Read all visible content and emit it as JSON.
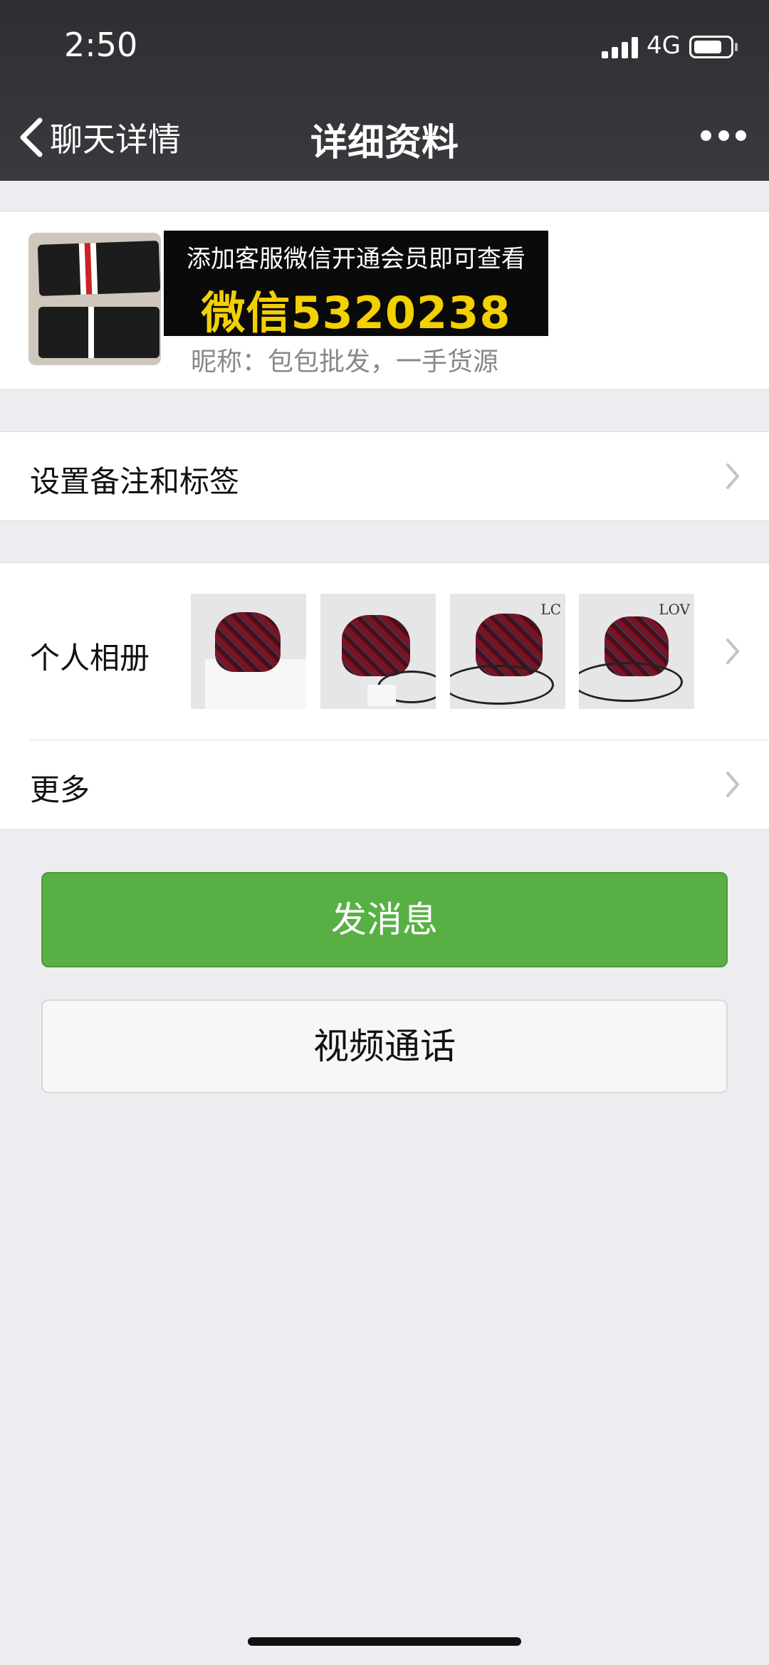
{
  "status_bar": {
    "time": "2:50",
    "network": "4G"
  },
  "nav": {
    "back_label": "聊天详情",
    "title": "详细资料"
  },
  "profile": {
    "banner_line1": "添加客服微信开通会员即可查看",
    "banner_line2": "微信5320238",
    "nickname": "昵称：包包批发，一手货源"
  },
  "rows": {
    "remark": "设置备注和标签",
    "album": "个人相册",
    "more": "更多"
  },
  "album_thumbnails": [
    {
      "brand": ""
    },
    {
      "brand": ""
    },
    {
      "brand": "LC"
    },
    {
      "brand": "LOV"
    }
  ],
  "buttons": {
    "send_message": "发消息",
    "video_call": "视频通话"
  },
  "colors": {
    "nav_bg": "#2f2f33",
    "primary_green": "#58b044",
    "page_bg": "#ededf1",
    "banner_yellow": "#f3d000"
  }
}
